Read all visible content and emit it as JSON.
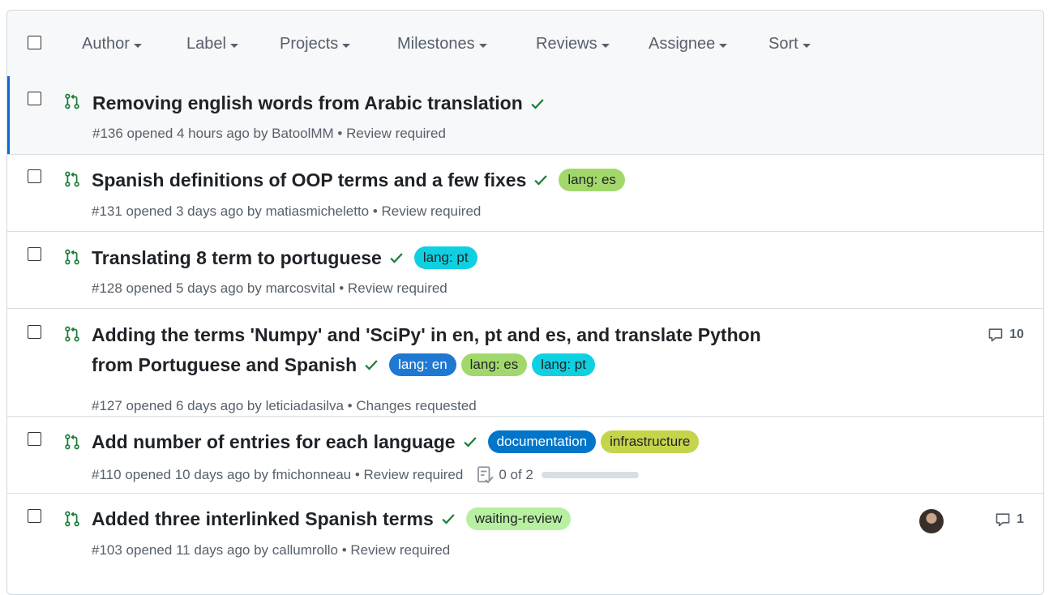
{
  "filters": {
    "author": "Author",
    "label": "Label",
    "projects": "Projects",
    "milestones": "Milestones",
    "reviews": "Reviews",
    "assignee": "Assignee",
    "sort": "Sort"
  },
  "colors": {
    "open_pr": "#1a7f37",
    "check": "#1a7f37",
    "lang_es": "#a2d86b",
    "lang_pt": "#0fd0e0",
    "lang_en": "#1f78d1",
    "documentation": "#0075ca",
    "infrastructure": "#c5d44a",
    "waiting_review": "#b7f0a0"
  },
  "pulls": [
    {
      "title": "Removing english words from Arabic translation",
      "meta": "#136 opened 4 hours ago by BatoolMM • Review required",
      "labels": []
    },
    {
      "title": "Spanish definitions of OOP terms and a few fixes",
      "meta": "#131 opened 3 days ago by matiasmicheletto • Review required",
      "labels": [
        "lang: es"
      ]
    },
    {
      "title": "Translating 8 term to portuguese",
      "meta": "#128 opened 5 days ago by marcosvital • Review required",
      "labels": [
        "lang: pt"
      ]
    },
    {
      "title_line1": "Adding the terms 'Numpy' and 'SciPy' in en, pt and es, and translate Python",
      "title_line2": "from Portuguese and Spanish",
      "meta": "#127 opened 6 days ago by leticiadasilva • Changes requested",
      "labels": [
        "lang: en",
        "lang: es",
        "lang: pt"
      ],
      "comments": "10"
    },
    {
      "title": "Add number of entries for each language",
      "meta": "#110 opened 10 days ago by fmichonneau • Review required",
      "labels": [
        "documentation",
        "infrastructure"
      ],
      "tasks": "0 of 2",
      "tasks_progress": 0
    },
    {
      "title": "Added three interlinked Spanish terms",
      "meta": "#103 opened 11 days ago by callumrollo • Review required",
      "labels": [
        "waiting-review"
      ],
      "comments": "1"
    }
  ]
}
